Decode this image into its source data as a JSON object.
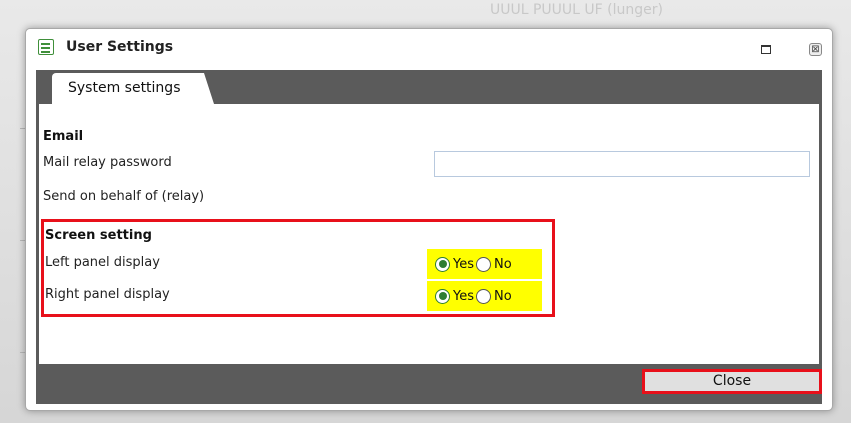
{
  "background": {
    "text": "UUUL PUUUL UF (lunger)"
  },
  "window": {
    "title": "User Settings",
    "title_icon": "settings-form-icon",
    "maximize_icon": "maximize-icon",
    "close_icon": "close-icon",
    "close_glyph": "⊠"
  },
  "tabs": [
    {
      "label": "System settings",
      "active": true
    }
  ],
  "email": {
    "heading": "Email",
    "mail_relay_password_label": "Mail relay password",
    "mail_relay_password_value": "",
    "send_on_behalf_label": "Send on behalf of (relay)"
  },
  "screen": {
    "heading": "Screen setting",
    "left_panel": {
      "label": "Left panel display",
      "yes": "Yes",
      "no": "No",
      "selected": "Yes"
    },
    "right_panel": {
      "label": "Right panel display",
      "yes": "Yes",
      "no": "No",
      "selected": "Yes"
    }
  },
  "footer": {
    "close_label": "Close"
  },
  "colors": {
    "highlight_red": "#e8101a",
    "highlight_yellow": "#ffff00",
    "frame_dark": "#5b5b5b",
    "radio_checked": "#2e7d32"
  }
}
